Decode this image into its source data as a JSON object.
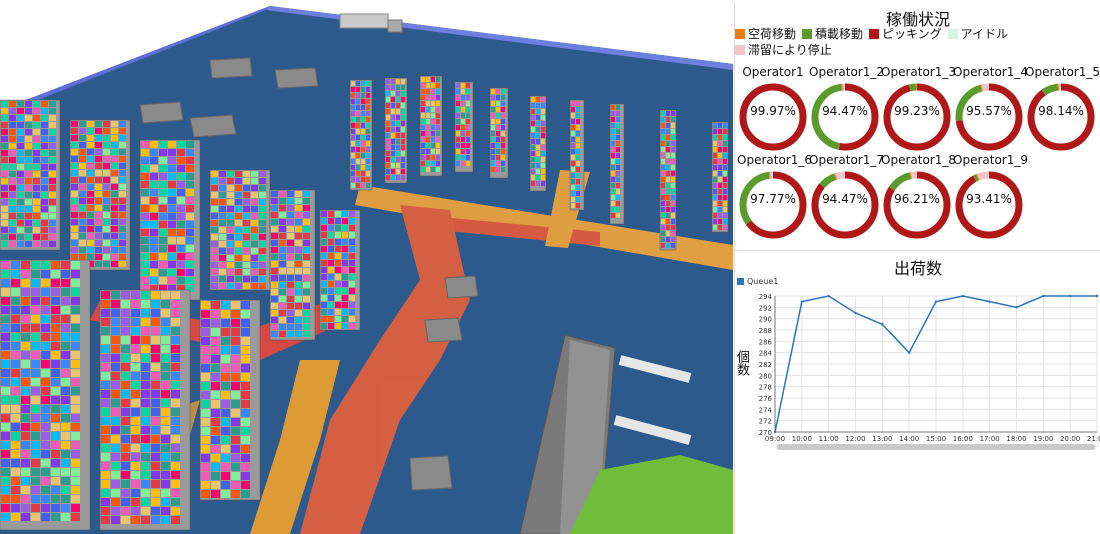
{
  "utilization": {
    "title": "稼働状況",
    "legend": [
      {
        "label": "空荷移動",
        "color": "#f07f09"
      },
      {
        "label": "積載移動",
        "color": "#5b9b2e"
      },
      {
        "label": "ピッキング",
        "color": "#b01818"
      },
      {
        "label": "アイドル",
        "color": "#d5f5e5"
      },
      {
        "label": "滞留により停止",
        "color": "#f2c4cc"
      }
    ],
    "operators": [
      {
        "name": "Operator1",
        "pct": "99.97%",
        "picking": 0.9997,
        "loaded": 0.0003
      },
      {
        "name": "Operator1_2",
        "pct": "94.47%",
        "picking": 0.53,
        "loaded": 0.45
      },
      {
        "name": "Operator1_3",
        "pct": "99.23%",
        "picking": 0.96,
        "loaded": 0.0323
      },
      {
        "name": "Operator1_4",
        "pct": "95.57%",
        "picking": 0.73,
        "loaded": 0.2257
      },
      {
        "name": "Operator1_5",
        "pct": "98.14%",
        "picking": 0.9,
        "loaded": 0.0814
      },
      {
        "name": "Operator1_6",
        "pct": "97.77%",
        "picking": 0.65,
        "loaded": 0.3277
      },
      {
        "name": "Operator1_7",
        "pct": "94.47%",
        "picking": 0.86,
        "loaded": 0.0847
      },
      {
        "name": "Operator1_8",
        "pct": "96.21%",
        "picking": 0.84,
        "loaded": 0.1221
      },
      {
        "name": "Operator1_9",
        "pct": "93.41%",
        "picking": 0.92,
        "loaded": 0.0141
      }
    ]
  },
  "shipments": {
    "title": "出荷数",
    "chart_data": {
      "type": "line",
      "title": "出荷数",
      "xlabel": "",
      "ylabel": "個数",
      "x": [
        "09:00",
        "10:00",
        "11:00",
        "12:00",
        "13:00",
        "14:00",
        "15:00",
        "16:00",
        "17:00",
        "18:00",
        "19:00",
        "20:00",
        "21:00"
      ],
      "series": [
        {
          "name": "Queue1",
          "color": "#2e75b6",
          "values": [
            270,
            293,
            294,
            291,
            289,
            284,
            293,
            294,
            293,
            292,
            294,
            294,
            294
          ]
        }
      ],
      "ylim": [
        270,
        294
      ],
      "yticks": [
        270,
        272,
        274,
        276,
        278,
        280,
        282,
        284,
        286,
        288,
        290,
        292,
        294
      ],
      "grid": true,
      "legend_position": "top-left"
    }
  }
}
